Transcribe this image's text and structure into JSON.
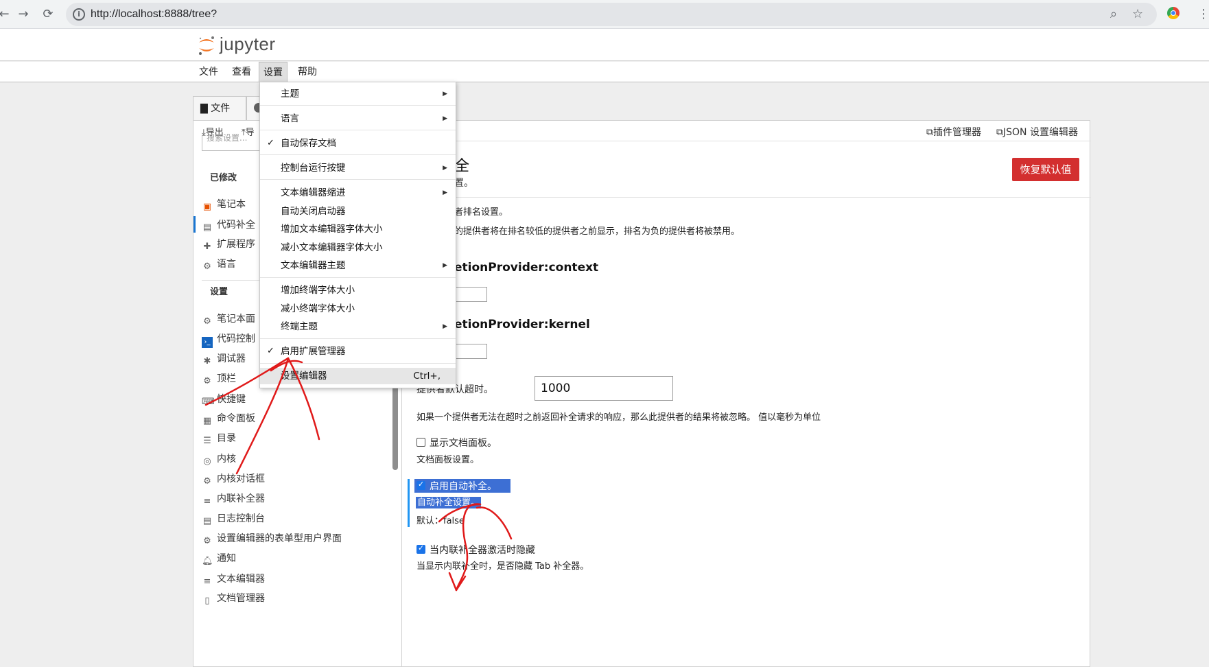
{
  "browser": {
    "url": "http://localhost:8888/tree?"
  },
  "app": {
    "logo_text": "jupyter",
    "menubar": [
      "文件",
      "查看",
      "设置",
      "帮助"
    ]
  },
  "left_panel": {
    "tabs": [
      "文件"
    ],
    "toolbar": {
      "export": "导出",
      "import": "导"
    },
    "search_placeholder": "搜索设置...",
    "section_modified": "已修改",
    "modified_items": [
      {
        "icon": "notebook-icon",
        "label": "笔记本"
      },
      {
        "icon": "code-completion-icon",
        "label": "代码补全"
      },
      {
        "icon": "extension-icon",
        "label": "扩展程序"
      },
      {
        "icon": "gear-icon",
        "label": "语言"
      }
    ],
    "section_settings": "设置",
    "settings_items": [
      {
        "icon": "gear-icon",
        "label": "笔记本面"
      },
      {
        "icon": "console-icon",
        "label": "代码控制"
      },
      {
        "icon": "bug-icon",
        "label": "调试器"
      },
      {
        "icon": "gear-icon",
        "label": "顶栏"
      },
      {
        "icon": "keyboard-icon",
        "label": "快捷键"
      },
      {
        "icon": "palette-icon",
        "label": "命令面板"
      },
      {
        "icon": "list-icon",
        "label": "目录"
      },
      {
        "icon": "kernel-icon",
        "label": "内核"
      },
      {
        "icon": "gear-icon",
        "label": "内核对话框"
      },
      {
        "icon": "lines-icon",
        "label": "内联补全器"
      },
      {
        "icon": "log-icon",
        "label": "日志控制台"
      },
      {
        "icon": "gear-icon",
        "label": "设置编辑器的表单型用户界面"
      },
      {
        "icon": "bell-icon",
        "label": "通知"
      },
      {
        "icon": "lines-icon",
        "label": "文本编辑器"
      },
      {
        "icon": "document-icon",
        "label": "文档管理器"
      }
    ]
  },
  "right_panel": {
    "plugin_manager": "插件管理器",
    "json_editor": "JSON 设置编辑器",
    "title": "全",
    "subtitle": "置。",
    "reset_button": "恢复默认值",
    "ranking_title": "者排名设置。",
    "ranking_desc": "的提供者将在排名较低的提供者之前显示，排名为负的提供者将被禁用。",
    "provider_context": "etionProvider:context",
    "provider_kernel": "etionProvider:kernel",
    "timeout_label": "提供者默认超时。",
    "timeout_value": "1000",
    "timeout_desc": "如果一个提供者无法在超时之前返回补全请求的响应，那么此提供者的结果将被忽略。 值以毫秒为单位",
    "doc_panel_label": "显示文档面板。",
    "doc_panel_desc": "文档面板设置。",
    "auto_complete_label": "启用自动补全。",
    "auto_complete_desc": "自动补全设置。",
    "auto_complete_default": "默认：false",
    "inline_hide_label": "当内联补全器激活时隐藏",
    "inline_hide_desc": "当显示内联补全时，是否隐藏 Tab 补全器。"
  },
  "settings_menu": {
    "items": [
      {
        "label": "主题",
        "submenu": true
      },
      {
        "label": "语言",
        "submenu": true
      },
      {
        "label": "自动保存文档",
        "checked": true
      },
      {
        "label": "控制台运行按键",
        "submenu": true
      },
      {
        "label": "文本编辑器缩进",
        "submenu": true
      },
      {
        "label": "自动关闭启动器"
      },
      {
        "label": "增加文本编辑器字体大小"
      },
      {
        "label": "减小文本编辑器字体大小"
      },
      {
        "label": "文本编辑器主题",
        "submenu": true
      },
      {
        "label": "增加终端字体大小"
      },
      {
        "label": "减小终端字体大小"
      },
      {
        "label": "终端主题",
        "submenu": true
      },
      {
        "label": "启用扩展管理器",
        "checked": true
      },
      {
        "label": "设置编辑器",
        "shortcut": "Ctrl+,"
      }
    ]
  },
  "colors": {
    "accent": "#1976d2",
    "reset": "#d32f2f",
    "highlight": "#3d6fd4",
    "annotation": "#e01a1a"
  }
}
